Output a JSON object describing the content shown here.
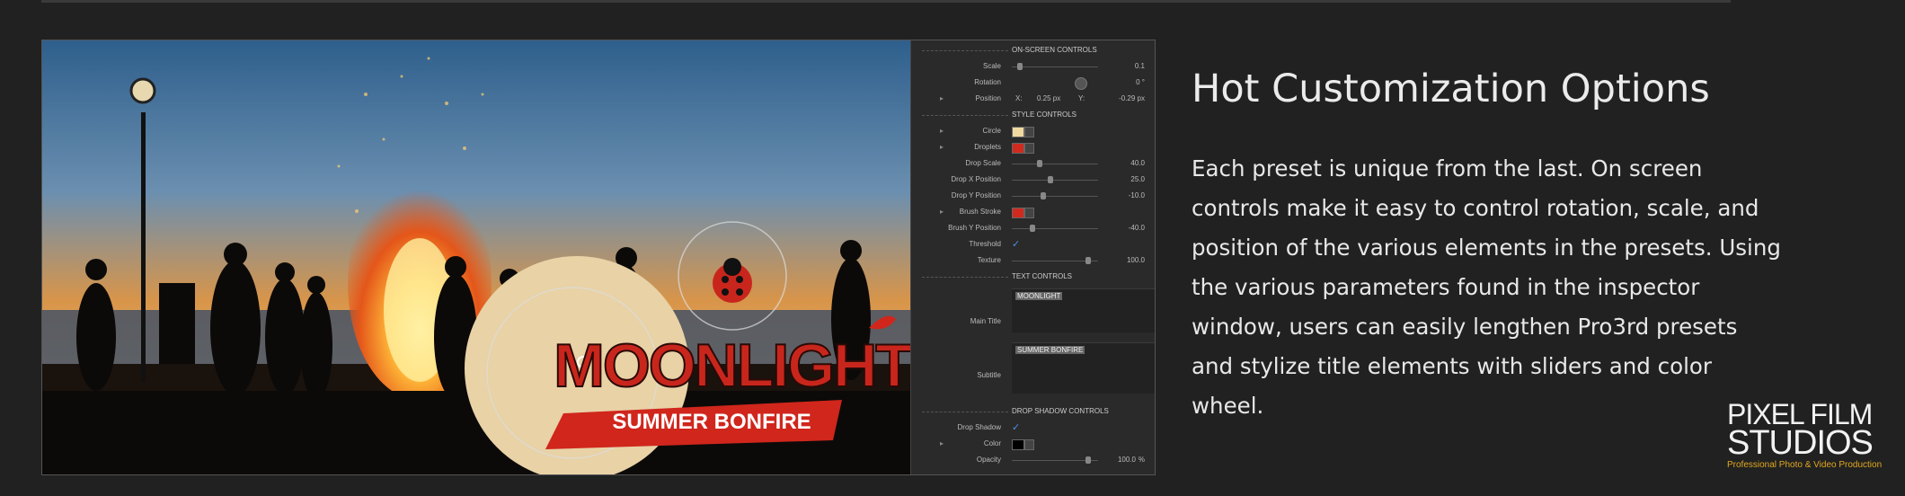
{
  "heading": "Hot Customization Options",
  "description": "Each preset is unique from the last. On screen controls make it easy to control rotation, scale, and position of the various elements in the presets. Using the various parameters found in the inspector window, users can easily lengthen Pro3rd presets and stylize title elements with sliders and color wheel.",
  "preview": {
    "title": "MOONLIGHT",
    "subtitle": "SUMMER BONFIRE"
  },
  "inspector": {
    "on_screen_controls": "ON-SCREEN CONTROLS",
    "scale_label": "Scale",
    "scale_value": "0.1",
    "rotation_label": "Rotation",
    "rotation_value": "0 °",
    "position_label": "Position",
    "position_x_label": "X:",
    "position_x": "0.25 px",
    "position_y_label": "Y:",
    "position_y": "-0.29 px",
    "style_controls": "STYLE CONTROLS",
    "circle_label": "Circle",
    "circle_color": "#f0d9a0",
    "droplets_label": "Droplets",
    "droplets_color": "#d02a1e",
    "drop_scale_label": "Drop Scale",
    "drop_scale_value": "40.0",
    "drop_x_label": "Drop X Position",
    "drop_x_value": "25.0",
    "drop_y_label": "Drop Y Position",
    "drop_y_value": "-10.0",
    "brush_stroke_label": "Brush Stroke",
    "brush_stroke_color": "#d02a1e",
    "brush_y_label": "Brush Y Position",
    "brush_y_value": "-40.0",
    "threshold_label": "Threshold",
    "texture_label": "Texture",
    "texture_value": "100.0",
    "text_controls": "TEXT CONTROLS",
    "main_title_label": "Main Title",
    "main_title_value": "MOONLIGHT",
    "subtitle_label": "Subtitle",
    "subtitle_value": "SUMMER BONFIRE",
    "drop_shadow_controls": "DROP SHADOW CONTROLS",
    "drop_shadow_label": "Drop Shadow",
    "color_label": "Color",
    "color_value": "#000000",
    "opacity_label": "Opacity",
    "opacity_value": "100.0",
    "opacity_unit": "%"
  },
  "logo": {
    "line1": "PIXEL FILM",
    "line2": "STUDIOS",
    "tagline": "Professional Photo & Video Production"
  }
}
